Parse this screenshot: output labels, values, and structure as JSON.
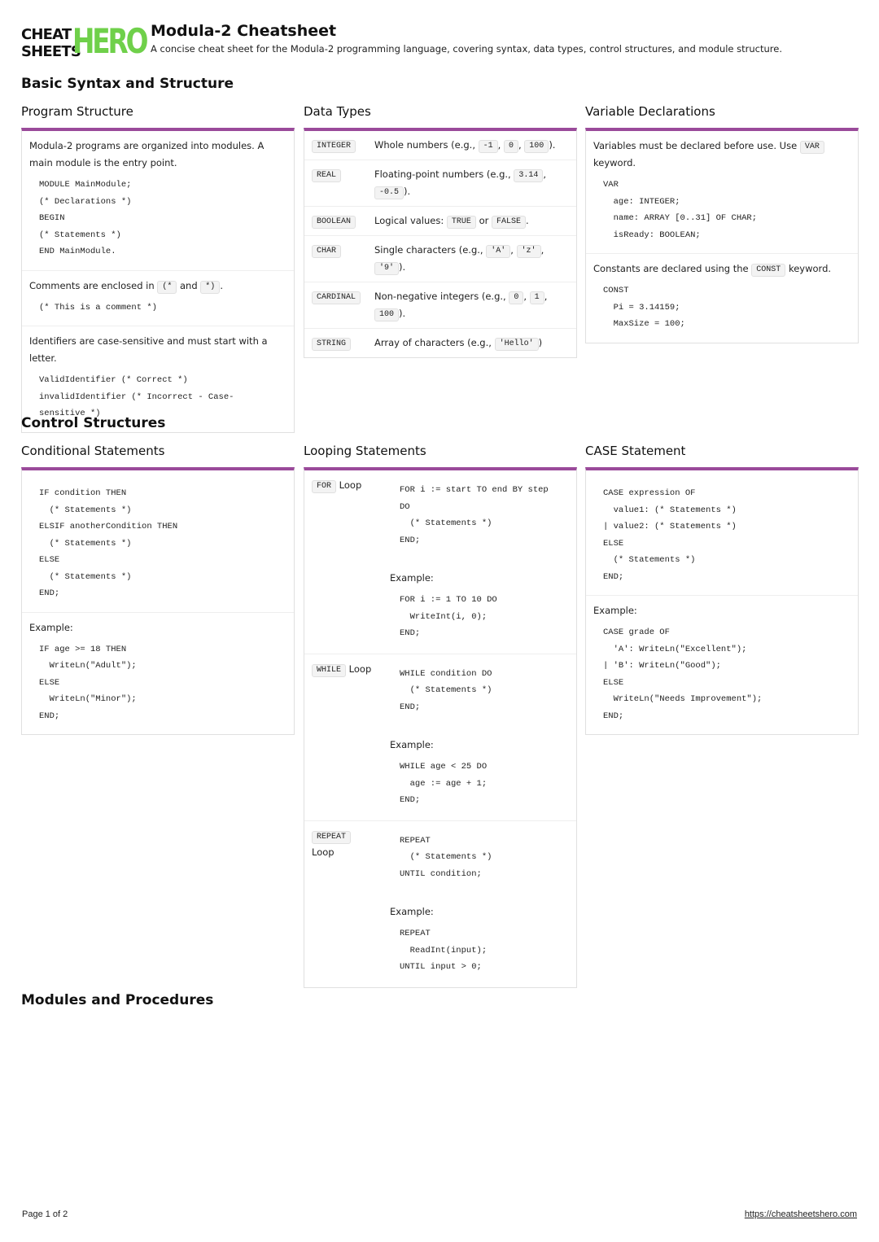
{
  "header": {
    "logo_line1": "CHEAT",
    "logo_line2": "SHEETS",
    "logo_hero": "HERO",
    "title": "Modula-2 Cheatsheet",
    "subtitle": "A concise cheat sheet for the Modula-2 programming language, covering syntax, data types, control structures, and module structure."
  },
  "sections": {
    "basic": "Basic Syntax and Structure",
    "control": "Control Structures",
    "modules": "Modules and Procedures"
  },
  "program_structure": {
    "title": "Program Structure",
    "intro": "Modula-2 programs are organized into modules. A main module is the entry point.",
    "code1": "MODULE MainModule;\n(* Declarations *)\nBEGIN\n(* Statements *)\nEND MainModule.",
    "comments_pre": "Comments are enclosed in",
    "comments_open": "(*",
    "comments_and": "and",
    "comments_close": "*)",
    "comments_post": ".",
    "code2": "(* This is a comment *)",
    "identifiers": "Identifiers are case-sensitive and must start with a letter.",
    "code3": "ValidIdentifier (* Correct *)\ninvalidIdentifier (* Incorrect - Case-\nsensitive *)"
  },
  "data_types": {
    "title": "Data Types",
    "rows": [
      {
        "key": "INTEGER",
        "desc_pre": "Whole numbers (e.g.,",
        "examples": [
          "-1",
          "0",
          "100"
        ],
        "desc_post": ")."
      },
      {
        "key": "REAL",
        "desc_pre": "Floating-point numbers (e.g.,",
        "examples": [
          "3.14",
          "-0.5"
        ],
        "desc_post": ")."
      },
      {
        "key": "BOOLEAN",
        "desc_pre": "Logical values:",
        "examples": [
          "TRUE",
          "FALSE"
        ],
        "joiner": "or",
        "desc_post": "."
      },
      {
        "key": "CHAR",
        "desc_pre": "Single characters (e.g.,",
        "examples": [
          "'A'",
          "'z'",
          "'9'"
        ],
        "desc_post": ")."
      },
      {
        "key": "CARDINAL",
        "desc_pre": "Non-negative integers (e.g.,",
        "examples": [
          "0",
          "1",
          "100"
        ],
        "desc_post": ")."
      },
      {
        "key": "STRING",
        "desc_pre": "Array of characters (e.g.,",
        "examples": [
          "'Hello'"
        ],
        "desc_post": ")"
      }
    ]
  },
  "variable_declarations": {
    "title": "Variable Declarations",
    "intro_pre": "Variables must be declared before use. Use",
    "intro_kw": "VAR",
    "intro_post": "keyword.",
    "code1": "VAR\n  age: INTEGER;\n  name: ARRAY [0..31] OF CHAR;\n  isReady: BOOLEAN;",
    "const_pre": "Constants are declared using the",
    "const_kw": "CONST",
    "const_post": "keyword.",
    "code2": "CONST\n  Pi = 3.14159;\n  MaxSize = 100;"
  },
  "conditional": {
    "title": "Conditional Statements",
    "code1": "IF condition THEN\n  (* Statements *)\nELSIF anotherCondition THEN\n  (* Statements *)\nELSE\n  (* Statements *)\nEND;",
    "example_label": "Example:",
    "code2": "IF age >= 18 THEN\n  WriteLn(\"Adult\");\nELSE\n  WriteLn(\"Minor\");\nEND;"
  },
  "looping": {
    "title": "Looping Statements",
    "rows": [
      {
        "kw": "FOR",
        "label": "Loop",
        "code": "FOR i := start TO end BY step\nDO\n  (* Statements *)\nEND;",
        "example_label": "Example:",
        "example": "FOR i := 1 TO 10 DO\n  WriteInt(i, 0);\nEND;"
      },
      {
        "kw": "WHILE",
        "label": "Loop",
        "code": "WHILE condition DO\n  (* Statements *)\nEND;",
        "example_label": "Example:",
        "example": "WHILE age < 25 DO\n  age := age + 1;\nEND;"
      },
      {
        "kw": "REPEAT",
        "label": "Loop",
        "code": "REPEAT\n  (* Statements *)\nUNTIL condition;",
        "example_label": "Example:",
        "example": "REPEAT\n  ReadInt(input);\nUNTIL input > 0;"
      }
    ]
  },
  "case_statement": {
    "title": "CASE Statement",
    "code1": "CASE expression OF\n  value1: (* Statements *)\n| value2: (* Statements *)\nELSE\n  (* Statements *)\nEND;",
    "example_label": "Example:",
    "code2": "CASE grade OF\n  'A': WriteLn(\"Excellent\");\n| 'B': WriteLn(\"Good\");\nELSE\n  WriteLn(\"Needs Improvement\");\nEND;"
  },
  "footer": {
    "page": "Page 1 of 2",
    "url": "https://cheatsheetshero.com"
  }
}
